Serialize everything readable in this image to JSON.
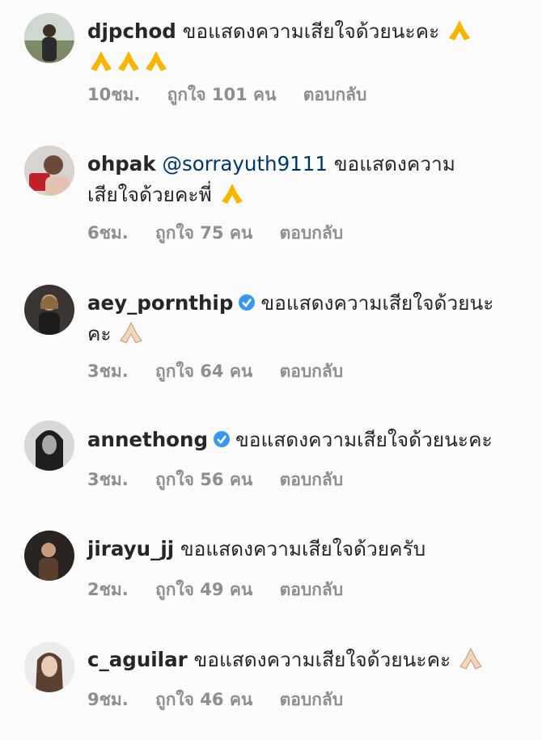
{
  "comments": [
    {
      "username": "djpchod",
      "verified": false,
      "mention": "",
      "text_line1": "ขอแสดงความเสียใจด้วยนะคะ",
      "text_line2": "",
      "emoji_line1": 1,
      "emoji_line2": 3,
      "emoji_icon": "folded-hands-icon",
      "time": "10ชม.",
      "likes": "ถูกใจ 101 คน",
      "reply": "ตอบกลับ"
    },
    {
      "username": "ohpak",
      "verified": false,
      "mention": "@sorrayuth9111",
      "text_line1": "ขอแสดงความ",
      "text_line2": "เสียใจด้วยคะพี่",
      "emoji_line1": 0,
      "emoji_line2": 1,
      "emoji_icon": "folded-hands-icon",
      "time": "6ชม.",
      "likes": "ถูกใจ 75 คน",
      "reply": "ตอบกลับ"
    },
    {
      "username": "aey_pornthip",
      "verified": true,
      "mention": "",
      "text_line1": "ขอแสดงความเสียใจด้วยนะ",
      "text_line2": "คะ",
      "emoji_line1": 0,
      "emoji_line2": 1,
      "emoji_icon": "folded-hands-light-icon",
      "time": "3ชม.",
      "likes": "ถูกใจ 64 คน",
      "reply": "ตอบกลับ"
    },
    {
      "username": "annethong",
      "verified": true,
      "mention": "",
      "text_line1": "ขอแสดงความเสียใจด้วยนะคะ",
      "text_line2": "",
      "emoji_line1": 0,
      "emoji_line2": 0,
      "emoji_icon": "",
      "time": "3ชม.",
      "likes": "ถูกใจ 56 คน",
      "reply": "ตอบกลับ"
    },
    {
      "username": "jirayu_jj",
      "verified": false,
      "mention": "",
      "text_line1": "ขอแสดงความเสียใจด้วยครับ",
      "text_line2": "",
      "emoji_line1": 0,
      "emoji_line2": 0,
      "emoji_icon": "",
      "time": "2ชม.",
      "likes": "ถูกใจ 49 คน",
      "reply": "ตอบกลับ"
    },
    {
      "username": "c_aguilar",
      "verified": false,
      "mention": "",
      "text_line1": "ขอแสดงความเสียใจด้วยนะคะ",
      "text_line2": "",
      "emoji_line1": 1,
      "emoji_line2": 0,
      "emoji_icon": "folded-hands-light-icon",
      "time": "9ชม.",
      "likes": "ถูกใจ 46 คน",
      "reply": "ตอบกลับ"
    }
  ],
  "colors": {
    "username": "#262626",
    "mention": "#00376b",
    "meta": "#8e8e8e",
    "verified": "#3897f0",
    "emoji_yellow": "#f7b500",
    "emoji_light": "#f3d7b8"
  }
}
